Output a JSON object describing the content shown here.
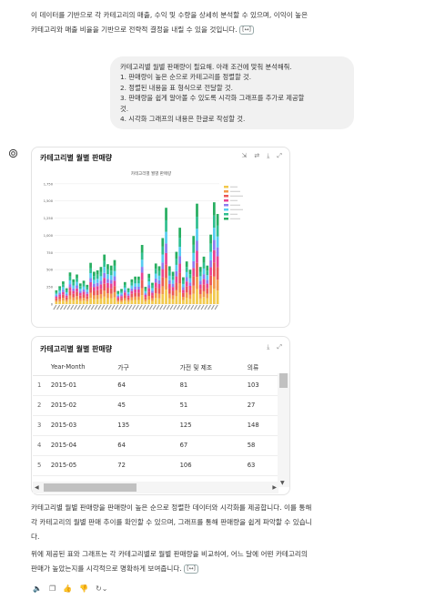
{
  "intro": {
    "line1": "이 데이터를 기반으로 각 카테고리의 매출, 수익 및 수량을 상세히 분석할 수 있으며, 이익이 높은",
    "line2": "카테고리와 매출 비율을 기반으로 전략적 결정을 내릴 수 있을 것입니다.",
    "cite": "[↔]"
  },
  "user_message": {
    "lines": [
      "카테고리별 월별 판매량이 필요해. 아래 조건에 맞춰 분석해줘.",
      "1. 판매량이 높은 순으로 카테고리를 정렬할 것.",
      "2. 정렬된 내용을 표 형식으로 전달할 것.",
      "3. 판매량을 쉽게 알아볼 수 있도록 시각화 그래프를 추가로 제공할",
      "것.",
      "4. 시각화 그래프의 내용은 한글로 작성할 것."
    ]
  },
  "chart_card": {
    "title": "카테고리별 월별 판매량",
    "tools": [
      "share-icon",
      "refresh-icon",
      "download-icon",
      "expand-icon"
    ]
  },
  "chart_data": {
    "type": "bar",
    "stacked": true,
    "title": "카테고리별 월별 판매량",
    "xlabel": "",
    "ylabel": "",
    "ylim": [
      0,
      1800
    ],
    "yticks": [
      0,
      250,
      500,
      750,
      1000,
      1250,
      1500,
      1750
    ],
    "n_bars": 48,
    "totals": [
      200,
      260,
      330,
      230,
      460,
      360,
      430,
      300,
      340,
      280,
      600,
      470,
      490,
      540,
      720,
      580,
      560,
      640,
      190,
      220,
      320,
      230,
      360,
      400,
      400,
      860,
      250,
      440,
      310,
      590,
      550,
      960,
      1400,
      550,
      470,
      760,
      1110,
      390,
      620,
      500,
      990,
      1460,
      540,
      690,
      560,
      1010,
      1480,
      1310
    ],
    "series_colors": [
      "#f2c94c",
      "#f2994a",
      "#eb5757",
      "#e84393",
      "#8e7cf0",
      "#56ccf2",
      "#2fbf8f",
      "#27ae60"
    ]
  },
  "table_card": {
    "title": "카테고리별 월별 판매량",
    "columns": [
      "",
      "Year-Month",
      "가구",
      "가전 및 제조",
      "의류"
    ],
    "rows": [
      [
        "1",
        "2015-01",
        "64",
        "81",
        "103"
      ],
      [
        "2",
        "2015-02",
        "45",
        "51",
        "27"
      ],
      [
        "3",
        "2015-03",
        "135",
        "125",
        "148"
      ],
      [
        "4",
        "2015-04",
        "64",
        "67",
        "58"
      ],
      [
        "5",
        "2015-05",
        "72",
        "106",
        "63"
      ]
    ]
  },
  "summary": {
    "p1_line1": "카테고리별 월별 판매량을 판매량이 높은 순으로 정렬한 데이터와 시각화를 제공합니다. 이를 통해",
    "p1_line2": "각 카테고리의 월별 판매 추이를 확인할 수 있으며, 그래프를 통해 판매량을 쉽게 파악할 수 있습니",
    "p1_line3": "다.",
    "p2_line1": "위에 제공된 표와 그래프는 각 카테고리별로 월별 판매량을 비교하여, 어느 달에 어떤 카테고리의",
    "p2_line2": "판매가 높았는지를 시각적으로 명확하게 보여줍니다.",
    "cite": "[↔]"
  },
  "actions": [
    "speaker-icon",
    "copy-icon",
    "thumbs-up-icon",
    "thumbs-down-icon",
    "regenerate-icon"
  ]
}
